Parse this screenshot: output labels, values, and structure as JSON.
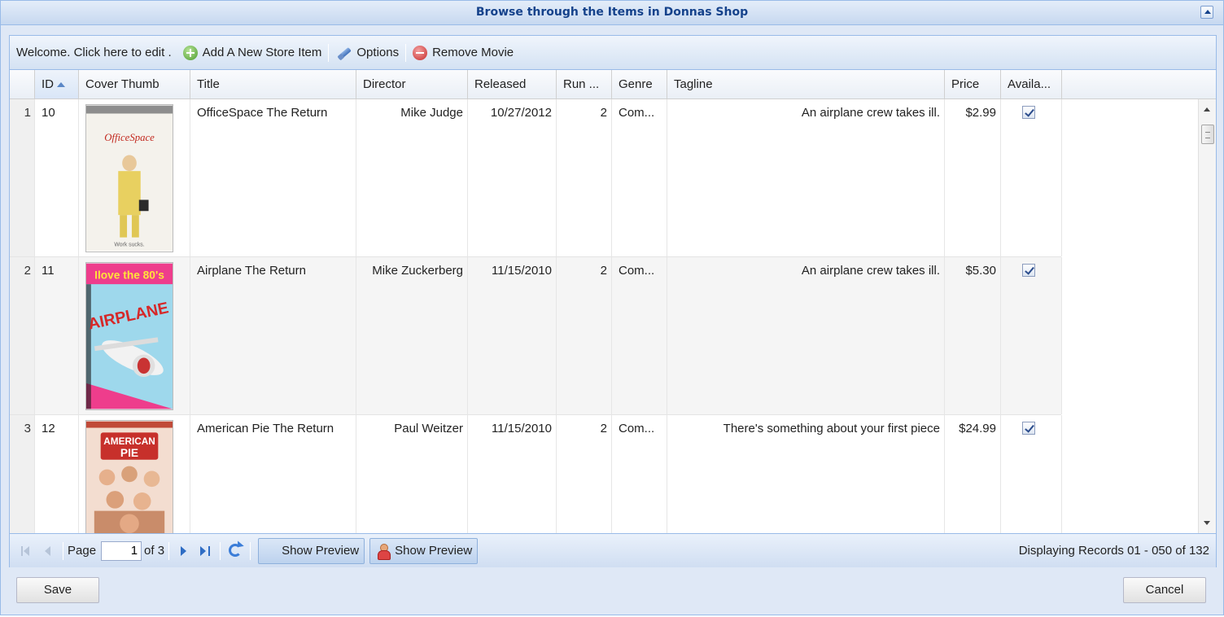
{
  "window": {
    "title": "Browse through the Items in Donnas Shop"
  },
  "toolbar": {
    "welcome_text": "Welcome. Click here to edit .",
    "add_label": "Add A New Store Item",
    "options_label": "Options",
    "remove_label": "Remove Movie"
  },
  "grid": {
    "columns": {
      "id": "ID",
      "cover": "Cover Thumb",
      "title": "Title",
      "director": "Director",
      "released": "Released",
      "runtime": "Run ...",
      "genre": "Genre",
      "tagline": "Tagline",
      "price": "Price",
      "available": "Availa..."
    },
    "sort": {
      "column": "ID",
      "direction": "ascending"
    },
    "rows": [
      {
        "rownum": "1",
        "id": "10",
        "title": "OfficeSpace The Return",
        "director": "Mike Judge",
        "released": "10/27/2012",
        "runtime": "2",
        "genre": "Com...",
        "tagline": "An airplane crew takes ill.",
        "price": "$2.99",
        "available": true,
        "cover_alt": "Office Space DVD cover"
      },
      {
        "rownum": "2",
        "id": "11",
        "title": "Airplane The Return",
        "director": "Mike Zuckerberg",
        "released": "11/15/2010",
        "runtime": "2",
        "genre": "Com...",
        "tagline": "An airplane crew takes ill.",
        "price": "$5.30",
        "available": true,
        "cover_alt": "I love the 80's Airplane cover"
      },
      {
        "rownum": "3",
        "id": "12",
        "title": "American Pie The Return",
        "director": "Paul Weitzer",
        "released": "11/15/2010",
        "runtime": "2",
        "genre": "Com...",
        "tagline": "There's something about your first piece",
        "price": "$24.99",
        "available": true,
        "cover_alt": "American Pie DVD cover"
      }
    ]
  },
  "paging": {
    "page_label": "Page",
    "current_page": "1",
    "of_label": "of 3",
    "preview_label_1": "Show Preview",
    "preview_label_2": "Show Preview",
    "display_info": "Displaying Records 01 - 050 of 132"
  },
  "footer": {
    "save_label": "Save",
    "cancel_label": "Cancel"
  }
}
